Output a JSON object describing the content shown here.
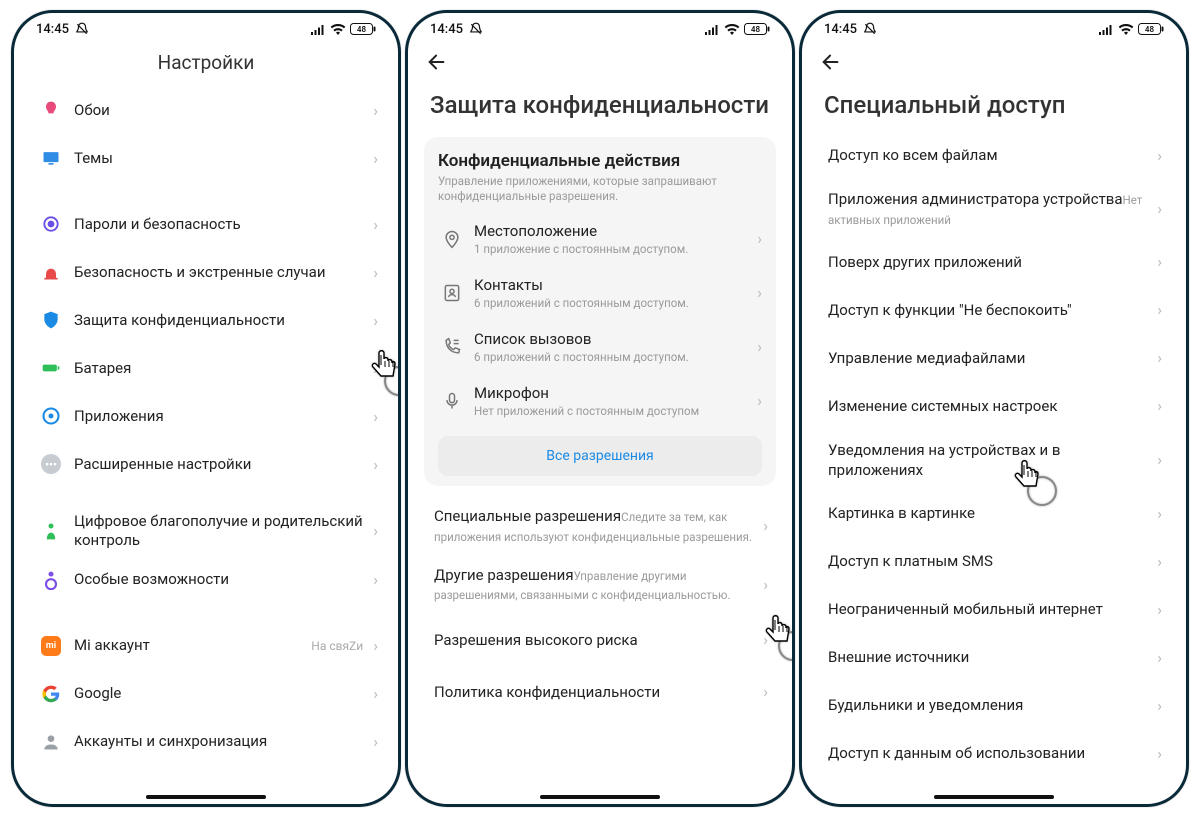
{
  "status": {
    "time": "14:45",
    "battery": "48"
  },
  "screen1": {
    "title": "Настройки",
    "groups": [
      [
        {
          "icon": "wallpaper",
          "color": "#e84a7a",
          "label": "Обои"
        },
        {
          "icon": "themes",
          "color": "#2f8de6",
          "label": "Темы"
        }
      ],
      [
        {
          "icon": "security",
          "color": "#6b4de6",
          "label": "Пароли и безопасность"
        },
        {
          "icon": "emergency",
          "color": "#e84a4a",
          "label": "Безопасность и экстренные случаи"
        },
        {
          "icon": "privacy",
          "color": "#1a8ae5",
          "label": "Защита конфиденциальности"
        },
        {
          "icon": "battery",
          "color": "#2fbf5a",
          "label": "Батарея"
        },
        {
          "icon": "apps",
          "color": "#1a8ae5",
          "label": "Приложения"
        },
        {
          "icon": "advanced",
          "color": "#bfc6d0",
          "label": "Расширенные настройки"
        }
      ],
      [
        {
          "icon": "wellbeing",
          "color": "#2fbf5a",
          "label": "Цифровое благополучие и родительский контроль"
        },
        {
          "icon": "accessibility",
          "color": "#7a4de6",
          "label": "Особые возможности"
        }
      ],
      [
        {
          "icon": "mi",
          "color": "#ff7b1a",
          "label": "Mi аккаунт",
          "status": "На свяZи"
        },
        {
          "icon": "google",
          "label": "Google"
        },
        {
          "icon": "sync",
          "color": "#9aa0a6",
          "label": "Аккаунты и синхронизация"
        }
      ]
    ]
  },
  "screen2": {
    "title": "Защита конфиденциальности",
    "card": {
      "title": "Конфиденциальные действия",
      "sub": "Управление приложениями, которые запрашивают конфиденциальные разрешения.",
      "items": [
        {
          "icon": "location",
          "label": "Местоположение",
          "sub": "1 приложение с постоянным доступом."
        },
        {
          "icon": "contacts",
          "label": "Контакты",
          "sub": "6 приложений с постоянным доступом."
        },
        {
          "icon": "calllog",
          "label": "Список вызовов",
          "sub": "6 приложений с постоянным доступом."
        },
        {
          "icon": "mic",
          "label": "Микрофон",
          "sub": "Нет приложений с постоянным доступом"
        }
      ],
      "all": "Все разрешения"
    },
    "rows": [
      {
        "label": "Специальные разрешения",
        "sub": "Следите за тем, как приложения используют конфиденциальные разрешения."
      },
      {
        "label": "Другие разрешения",
        "sub": "Управление другими разрешениями, связанными с конфиденциальностью."
      },
      {
        "label": "Разрешения высокого риска"
      },
      {
        "label": "Политика конфиденциальности"
      }
    ]
  },
  "screen3": {
    "title": "Специальный доступ",
    "rows": [
      {
        "label": "Доступ ко всем файлам"
      },
      {
        "label": "Приложения администратора устройства",
        "sub": "Нет активных приложений"
      },
      {
        "label": "Поверх других приложений"
      },
      {
        "label": "Доступ к функции \"Не беспокоить\""
      },
      {
        "label": "Управление медиафайлами"
      },
      {
        "label": "Изменение системных настроек"
      },
      {
        "label": "Уведомления на устройствах и в приложениях"
      },
      {
        "label": "Картинка в картинке"
      },
      {
        "label": "Доступ к платным SMS"
      },
      {
        "label": "Неограниченный мобильный интернет"
      },
      {
        "label": "Внешние источники"
      },
      {
        "label": "Будильники и уведомления"
      },
      {
        "label": "Доступ к данным об использовании"
      }
    ]
  }
}
